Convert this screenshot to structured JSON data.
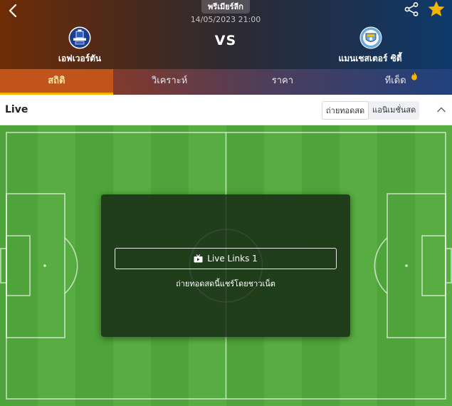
{
  "header": {
    "league": "พรีเมียร์ลีก",
    "datetime": "14/05/2023 21:00",
    "vs": "VS",
    "home_team": "เอฟเวอร์ตัน",
    "away_team": "แมนเชสเตอร์ ซิตี้",
    "icons": [
      "back-icon",
      "share-icon",
      "star-icon",
      "everton-logo",
      "man-city-logo"
    ],
    "colors": {
      "left": "#6e2c06",
      "right": "#0e3a6b",
      "star": "#f5b400"
    }
  },
  "tabs": [
    {
      "label": "สถิติ",
      "active": true
    },
    {
      "label": "วิเคราะห์",
      "active": false
    },
    {
      "label": "ราคา",
      "active": false
    },
    {
      "label": "ทีเด็ด",
      "active": false
    }
  ],
  "livebar": {
    "title": "Live",
    "options": [
      "ถ่ายทอดสด",
      "แอนิเมชั่นสด"
    ],
    "selected": "ถ่ายทอดสด"
  },
  "overlay": {
    "button_label": "Live Links 1",
    "note": "ถ่ายทอดสดนี้แชร์โดยชาวเน็ต"
  },
  "accent": {
    "tab_active_bg": "#c0541a",
    "tab_underline": "#ffb400",
    "pitch": "#4ea43a"
  }
}
